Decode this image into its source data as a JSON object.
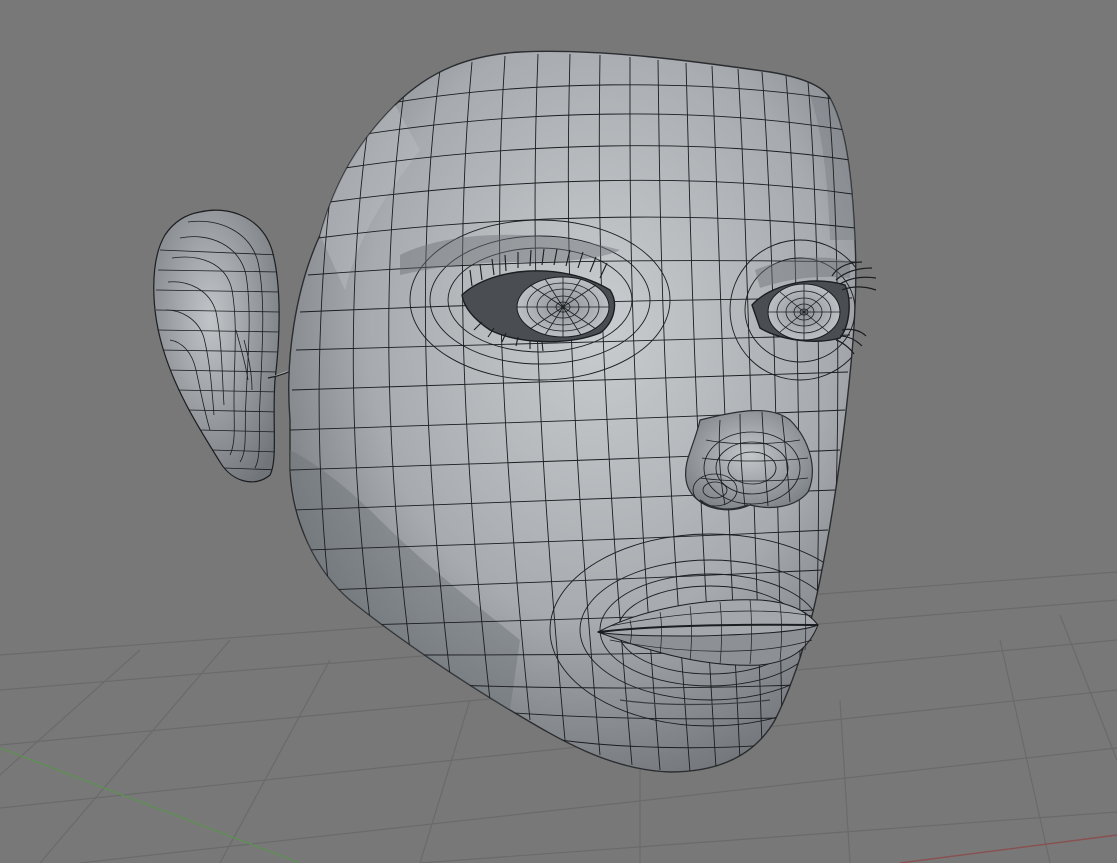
{
  "viewport": {
    "background": "#787878",
    "grid_color": "#6a6a6a",
    "x_axis_color": "#8a5050",
    "y_axis_color": "#5f8f55",
    "mesh_fill": "#9ea2a6",
    "mesh_highlight": "#c9ccce",
    "mesh_shadow": "#5d6166",
    "wire_color": "#1b1d20"
  },
  "scene": {
    "objects": [
      {
        "name": "head",
        "icon": "head-mesh"
      },
      {
        "name": "ear",
        "icon": "ear-mesh"
      },
      {
        "name": "left-eye",
        "icon": "eyeball-mesh"
      },
      {
        "name": "right-eye",
        "icon": "eyeball-mesh"
      },
      {
        "name": "eyelashes",
        "icon": "eyelash-curves"
      }
    ]
  }
}
